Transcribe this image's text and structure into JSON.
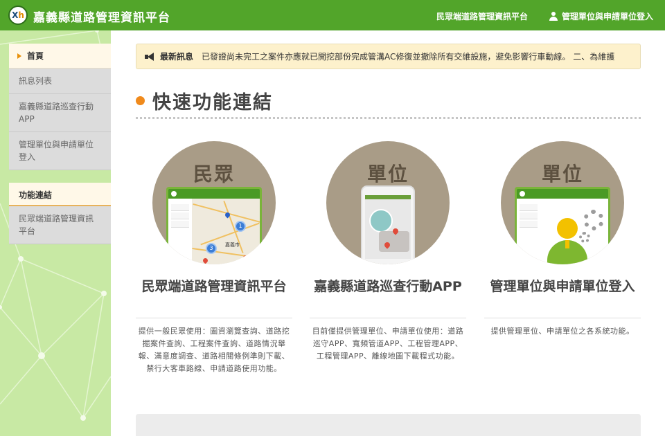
{
  "header": {
    "site_title": "嘉義縣道路管理資訊平台",
    "nav_public": "民眾端道路管理資訊平台",
    "nav_login": "管理單位與申請單位登入",
    "logo_icon": "county-logo-icon",
    "brand_color": "#52a52a"
  },
  "sidebar": {
    "items": [
      {
        "label": "首頁"
      },
      {
        "label": "訊息列表"
      },
      {
        "label": "嘉義縣道路巡查行動APP"
      },
      {
        "label": "管理單位與申請單位登入"
      }
    ],
    "group_title": "功能連結",
    "group_items": [
      {
        "label": "民眾端道路管理資訊平台"
      }
    ]
  },
  "news": {
    "label": "最新訊息",
    "text": "已發證尚未完工之案件亦應就已開挖部份完成管溝AC修復並撤除所有交維設施，避免影響行車動線。 二、為維護"
  },
  "section": {
    "title": "快速功能連結"
  },
  "cards": [
    {
      "badge": "民眾",
      "title": "民眾端道路管理資訊平台",
      "desc": "提供一般民眾使用：圖資瀏覽查詢、道路挖掘案件查詢、工程案件查詢、道路情況舉報、滿意度調查、道路相關條例準則下載、禁行大客車路線、申請道路使用功能。",
      "map_city": "嘉義市",
      "cluster_a": "1",
      "cluster_b": "3"
    },
    {
      "badge": "單位",
      "title": "嘉義縣道路巡查行動APP",
      "desc": "目前僅提供管理單位、申請單位使用：道路巡守APP、寬頻管道APP、工程管理APP、工程管理APP、離線地圖下載程式功能。"
    },
    {
      "badge": "單位",
      "title": "管理單位與申請單位登入",
      "desc": "提供管理單位、申請單位之各系統功能。"
    }
  ]
}
